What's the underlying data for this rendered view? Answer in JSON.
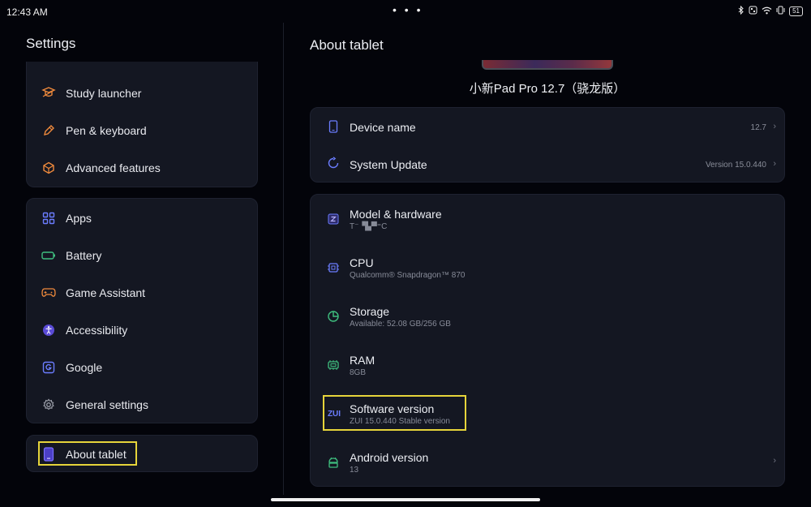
{
  "status_bar": {
    "time": "12:43 AM",
    "dots": "• • •",
    "battery": "51"
  },
  "left": {
    "title": "Settings",
    "group1": [
      {
        "label": "Study launcher",
        "icon": "study-launcher-icon"
      },
      {
        "label": "Pen & keyboard",
        "icon": "pen-icon"
      },
      {
        "label": "Advanced features",
        "icon": "advanced-features-icon"
      }
    ],
    "group2": [
      {
        "label": "Apps",
        "icon": "apps-grid-icon"
      },
      {
        "label": "Battery",
        "icon": "battery-icon"
      },
      {
        "label": "Game Assistant",
        "icon": "gamepad-icon"
      },
      {
        "label": "Accessibility",
        "icon": "accessibility-icon"
      },
      {
        "label": "Google",
        "icon": "google-icon"
      },
      {
        "label": "General settings",
        "icon": "gear-icon"
      }
    ],
    "about": {
      "label": "About tablet",
      "icon": "tablet-icon"
    }
  },
  "right": {
    "title": "About tablet",
    "device_name": "小新Pad Pro 12.7（骁龙版）",
    "card1": {
      "device_name": {
        "title": "Device name",
        "value": "12.7"
      },
      "system_update": {
        "title": "System Update",
        "value": "Version 15.0.440"
      }
    },
    "card2": [
      {
        "title": "Model & hardware",
        "sub": "T⁻▝▙▀⁼C",
        "icon": "model-icon"
      },
      {
        "title": "CPU",
        "sub": "Qualcomm® Snapdragon™ 870",
        "icon": "cpu-icon"
      },
      {
        "title": "Storage",
        "sub": "Available: 52.08 GB/256 GB",
        "icon": "storage-icon"
      },
      {
        "title": "RAM",
        "sub": "8GB",
        "icon": "ram-icon"
      },
      {
        "title": "Software version",
        "sub": "ZUI 15.0.440 Stable version",
        "icon": "zui-icon",
        "icon_text": "ZUI"
      },
      {
        "title": "Android version",
        "sub": "13",
        "icon": "android-icon"
      }
    ]
  },
  "colors": {
    "background": "#03040a",
    "card": "#141722",
    "highlight": "#e6d43a",
    "icon_orange": "#f08a3c",
    "icon_blue": "#6b7dff",
    "icon_green": "#3fbf7f"
  }
}
